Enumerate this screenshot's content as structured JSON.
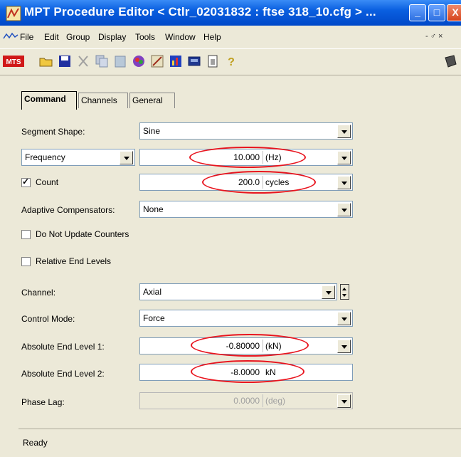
{
  "window": {
    "title": "MPT Procedure Editor   < Ctlr_02031832 : ftse 318_10.cfg > ...",
    "min_glyph": "_",
    "max_glyph": "□",
    "close_glyph": "X"
  },
  "menu": {
    "items": [
      "File",
      "Edit",
      "Group",
      "Display",
      "Tools",
      "Window",
      "Help"
    ],
    "mdi_controls": "- ♂ ×"
  },
  "toolbar": {
    "logo": "MTS",
    "icons": [
      "open-folder-icon",
      "save-icon",
      "cut-icon",
      "copy-icon",
      "paste-icon",
      "color-wheel-icon",
      "settings-icon",
      "chart-icon",
      "print-icon",
      "help-icon"
    ]
  },
  "tabs": [
    "Command",
    "Channels",
    "General"
  ],
  "form": {
    "segment_shape": {
      "label": "Segment Shape:",
      "value": "Sine"
    },
    "frequency": {
      "selector": "Frequency",
      "value": "10.000",
      "unit": "(Hz)"
    },
    "count": {
      "label": "Count",
      "checked": true,
      "value": "200.0",
      "unit": "cycles"
    },
    "adaptive": {
      "label": "Adaptive Compensators:",
      "value": "None"
    },
    "do_not_update": {
      "label": "Do Not Update Counters",
      "checked": false
    },
    "relative_end": {
      "label": "Relative End Levels",
      "checked": false
    },
    "channel": {
      "label": "Channel:",
      "value": "Axial"
    },
    "control_mode": {
      "label": "Control Mode:",
      "value": "Force"
    },
    "end_level_1": {
      "label": "Absolute End Level 1:",
      "value": "-0.80000",
      "unit": "(kN)"
    },
    "end_level_2": {
      "label": "Absolute End Level 2:",
      "value": "-8.0000",
      "unit": "kN"
    },
    "phase_lag": {
      "label": "Phase Lag:",
      "value": "0.0000",
      "unit": "(deg)"
    }
  },
  "status": {
    "text": "Ready"
  },
  "colors": {
    "annotation": "#e8141e",
    "title_bar": "#0a5fe0",
    "window_bg": "#ece9d8"
  }
}
